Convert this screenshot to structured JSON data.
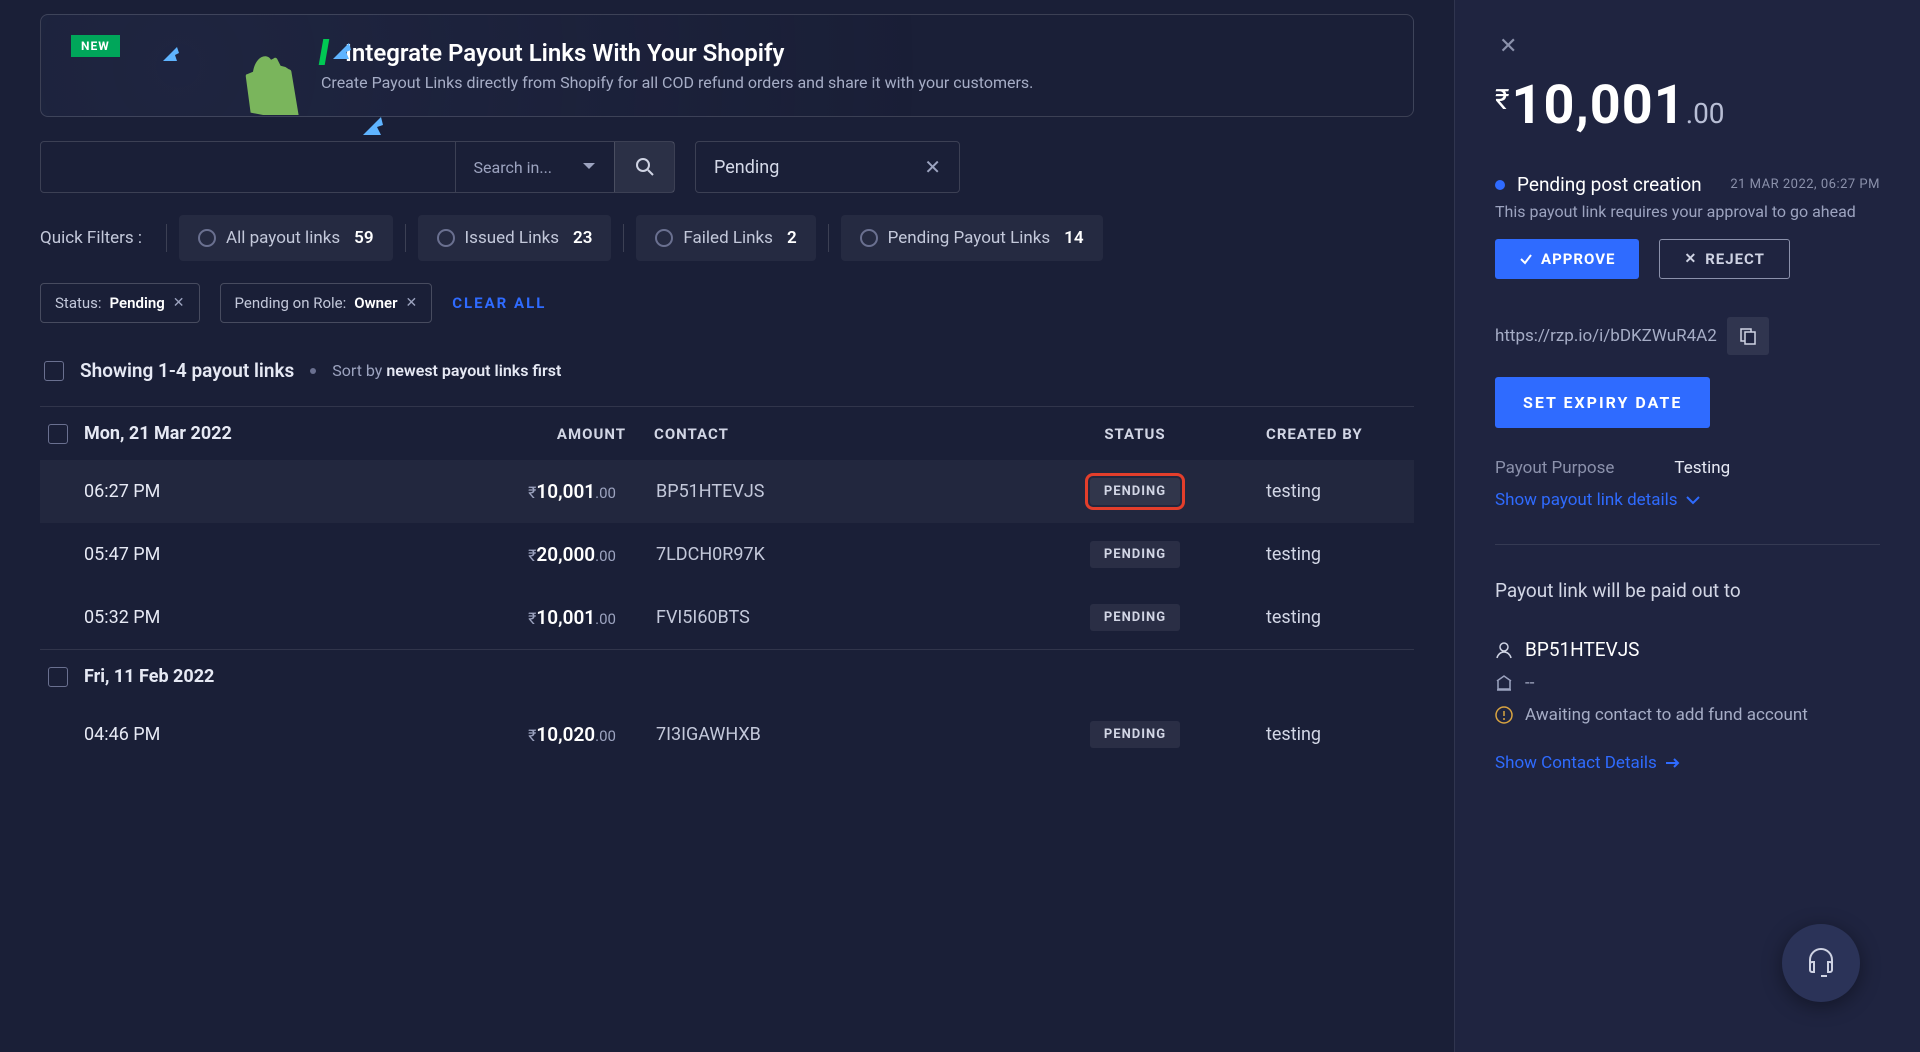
{
  "banner": {
    "new_label": "NEW",
    "title": "Integrate Payout Links With Your Shopify",
    "subtitle": "Create Payout Links directly from Shopify for all COD refund orders and share it with your customers."
  },
  "search": {
    "placeholder": "",
    "type_label": "Search in...",
    "status_value": "Pending"
  },
  "filters": {
    "label": "Quick Filters :",
    "items": [
      {
        "label": "All payout links",
        "count": "59"
      },
      {
        "label": "Issued Links",
        "count": "23"
      },
      {
        "label": "Failed Links",
        "count": "2"
      },
      {
        "label": "Pending Payout Links",
        "count": "14"
      }
    ]
  },
  "tags": {
    "status_prefix": "Status:",
    "status_value": "Pending",
    "role_prefix": "Pending on Role:",
    "role_value": "Owner",
    "clear": "CLEAR ALL"
  },
  "listing": {
    "showing": "Showing 1-4 payout links",
    "sort_prefix": "Sort by",
    "sort_value": "newest payout links first"
  },
  "columns": {
    "amount": "AMOUNT",
    "contact": "CONTACT",
    "status": "STATUS",
    "created": "CREATED BY"
  },
  "groups": [
    {
      "date": "Mon, 21 Mar 2022",
      "rows": [
        {
          "time": "06:27 PM",
          "amt_main": "10,001",
          "amt_dec": ".00",
          "contact": "BP51HTEVJS",
          "status": "PENDING",
          "created": "testing",
          "highlight": true,
          "selected": true
        },
        {
          "time": "05:47 PM",
          "amt_main": "20,000",
          "amt_dec": ".00",
          "contact": "7LDCH0R97K",
          "status": "PENDING",
          "created": "testing"
        },
        {
          "time": "05:32 PM",
          "amt_main": "10,001",
          "amt_dec": ".00",
          "contact": "FVI5I60BTS",
          "status": "PENDING",
          "created": "testing"
        }
      ]
    },
    {
      "date": "Fri, 11 Feb 2022",
      "rows": [
        {
          "time": "04:46 PM",
          "amt_main": "10,020",
          "amt_dec": ".00",
          "contact": "7I3IGAWHXB",
          "status": "PENDING",
          "created": "testing"
        }
      ]
    }
  ],
  "detail": {
    "currency": "₹",
    "amt_main": "10,001",
    "amt_dec": ".00",
    "status_title": "Pending post creation",
    "status_date": "21 MAR 2022, 06:27 PM",
    "status_desc": "This payout link requires your approval to go ahead",
    "approve": "APPROVE",
    "reject": "REJECT",
    "link": "https://rzp.io/i/bDKZWuR4A2",
    "expiry_btn": "SET EXPIRY DATE",
    "purpose_label": "Payout Purpose",
    "purpose_value": "Testing",
    "show_details": "Show payout link details",
    "paid_to_title": "Payout link will be paid out to",
    "contact_name": "BP51HTEVJS",
    "bank_value": "--",
    "warn_text": "Awaiting contact to add fund account",
    "show_contact": "Show Contact Details"
  }
}
